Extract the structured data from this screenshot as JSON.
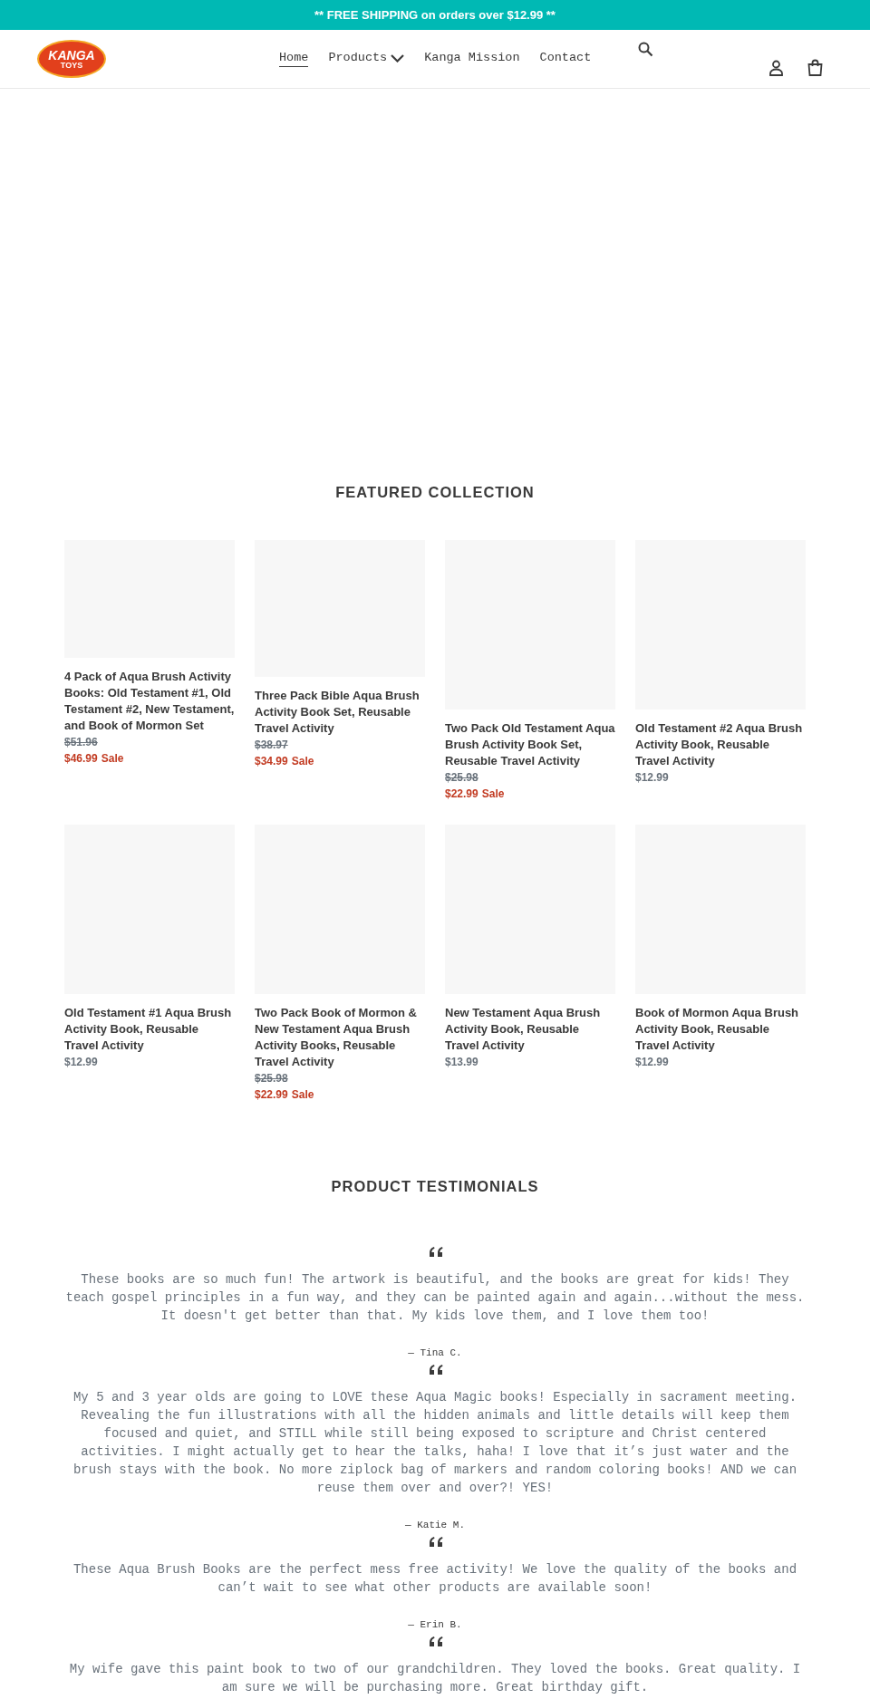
{
  "announcement": "** FREE SHIPPING on orders over $12.99 **",
  "logo": {
    "line_1": "KANGA",
    "line_2": "TOYS"
  },
  "nav": [
    {
      "label": "Home",
      "selected": true,
      "dropdown": false
    },
    {
      "label": "Products",
      "selected": false,
      "dropdown": true
    },
    {
      "label": "Kanga Mission",
      "selected": false,
      "dropdown": false
    },
    {
      "label": "Contact",
      "selected": false,
      "dropdown": false
    }
  ],
  "featured": {
    "heading": "FEATURED COLLECTION",
    "products": [
      {
        "title": "4 Pack of Aqua Brush Activity Books: Old Testament #1, Old Testament #2, New Testament, and Book of Mormon Set",
        "compare_price": "$51.96",
        "price": "$46.99",
        "on_sale": true,
        "sale_label": "Sale"
      },
      {
        "title": "Three Pack Bible Aqua Brush Activity Book Set, Reusable Travel Activity",
        "compare_price": "$38.97",
        "price": "$34.99",
        "on_sale": true,
        "sale_label": "Sale"
      },
      {
        "title": "Two Pack Old Testament Aqua Brush Activity Book Set, Reusable Travel Activity",
        "compare_price": "$25.98",
        "price": "$22.99",
        "on_sale": true,
        "sale_label": "Sale"
      },
      {
        "title": "Old Testament #2 Aqua Brush Activity Book, Reusable Travel Activity",
        "price": "$12.99",
        "on_sale": false
      },
      {
        "title": "Old Testament #1 Aqua Brush Activity Book, Reusable Travel Activity",
        "price": "$12.99",
        "on_sale": false
      },
      {
        "title": "Two Pack Book of Mormon & New Testament Aqua Brush Activity Books, Reusable Travel Activity",
        "compare_price": "$25.98",
        "price": "$22.99",
        "on_sale": true,
        "sale_label": "Sale"
      },
      {
        "title": "New Testament Aqua Brush Activity Book, Reusable Travel Activity",
        "price": "$13.99",
        "on_sale": false
      },
      {
        "title": "Book of Mormon Aqua Brush Activity Book, Reusable Travel Activity",
        "price": "$12.99",
        "on_sale": false
      }
    ]
  },
  "testimonials": {
    "heading": "PRODUCT TESTIMONIALS",
    "items": [
      {
        "text": "These books are so much fun! The artwork is beautiful, and the books are great for kids! They teach gospel principles in a fun way, and they can be painted again and again...without the mess. It doesn't get better than that. My kids love them, and I love them too!",
        "author": "— Tina C."
      },
      {
        "text": "My 5 and 3 year olds are going to LOVE these Aqua Magic books! Especially in sacrament meeting. Revealing the fun illustrations with all the hidden animals and little details will keep them focused and quiet, and STILL while still being exposed to scripture and Christ centered activities. I might actually get to hear the talks, haha! I love that it’s just water and the brush stays with the book. No more ziplock bag of markers and random coloring books! AND we can reuse them over and over?! YES!",
        "author": "— Katie M."
      },
      {
        "text": "These Aqua Brush Books are the perfect mess free activity! We love the quality of the books and can’t wait to see what other products are available soon!",
        "author": "— Erin B."
      },
      {
        "text": "My wife gave this paint book to two of our grandchildren. They loved the books. Great quality. I am sure we will be purchasing more. Great birthday gift."
      }
    ]
  }
}
